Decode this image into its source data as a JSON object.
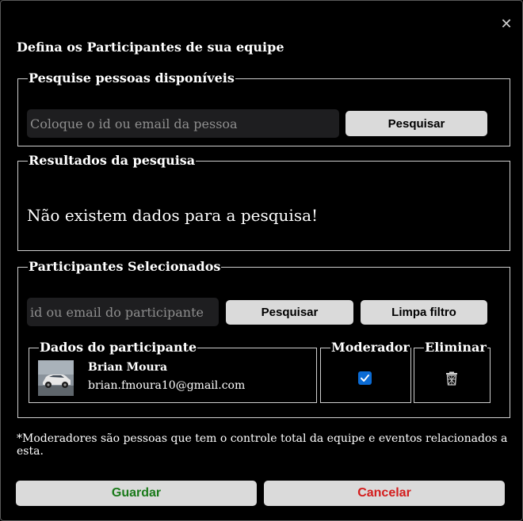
{
  "dialog": {
    "title": "Defina os Participantes de sua equipe",
    "close_symbol": "✕",
    "close_icon": "close-icon"
  },
  "search_section": {
    "legend": "Pesquise pessoas disponíveis",
    "input_placeholder": "Coloque o id ou email da pessoa",
    "input_value": "",
    "button_label": "Pesquisar"
  },
  "results_section": {
    "legend": "Resultados da pesquisa",
    "empty_message": "Não existem dados para a pesquisa!"
  },
  "selected_section": {
    "legend": "Participantes Selecionados",
    "filter_placeholder": "id ou email do participante",
    "filter_value": "",
    "search_button_label": "Pesquisar",
    "clear_button_label": "Limpa filtro",
    "columns": {
      "participant": "Dados do participante",
      "moderator": "Moderador",
      "remove": "Eliminar"
    },
    "participants": [
      {
        "name": "Brian Moura",
        "email": "brian.fmoura10@gmail.com",
        "avatar_icon": "car-photo-avatar",
        "moderator": true,
        "remove_icon": "trash-icon"
      }
    ]
  },
  "note": "*Moderadores são pessoas que tem o controle total da equipe e eventos relacionados a esta.",
  "footer": {
    "save_label": "Guardar",
    "save_color": "#1a7a1a",
    "cancel_label": "Cancelar",
    "cancel_color": "#d41c1c"
  },
  "colors": {
    "background": "#000000",
    "button_bg": "#dadada",
    "input_bg": "#1e1e20",
    "checkbox": "#0b6bd4"
  }
}
